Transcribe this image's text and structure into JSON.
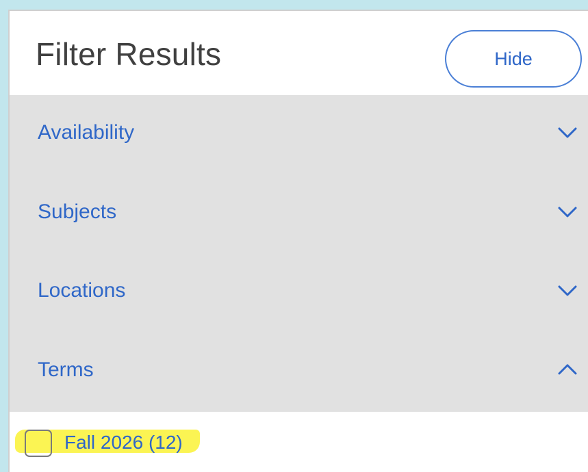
{
  "header": {
    "title": "Filter Results",
    "hide_label": "Hide"
  },
  "sections": [
    {
      "label": "Availability",
      "expanded": false,
      "icon": "chevron-down-icon"
    },
    {
      "label": "Subjects",
      "expanded": false,
      "icon": "chevron-down-icon"
    },
    {
      "label": "Locations",
      "expanded": false,
      "icon": "chevron-down-icon"
    },
    {
      "label": "Terms",
      "expanded": true,
      "icon": "chevron-up-icon"
    }
  ],
  "terms": {
    "options": [
      {
        "label": "Fall 2026 (12)",
        "checked": false,
        "highlighted": true
      }
    ]
  },
  "colors": {
    "accent": "#2f67c8",
    "section_background": "#e1e1e1",
    "page_background": "#c2e6ed",
    "highlight": "#fbf34a"
  }
}
